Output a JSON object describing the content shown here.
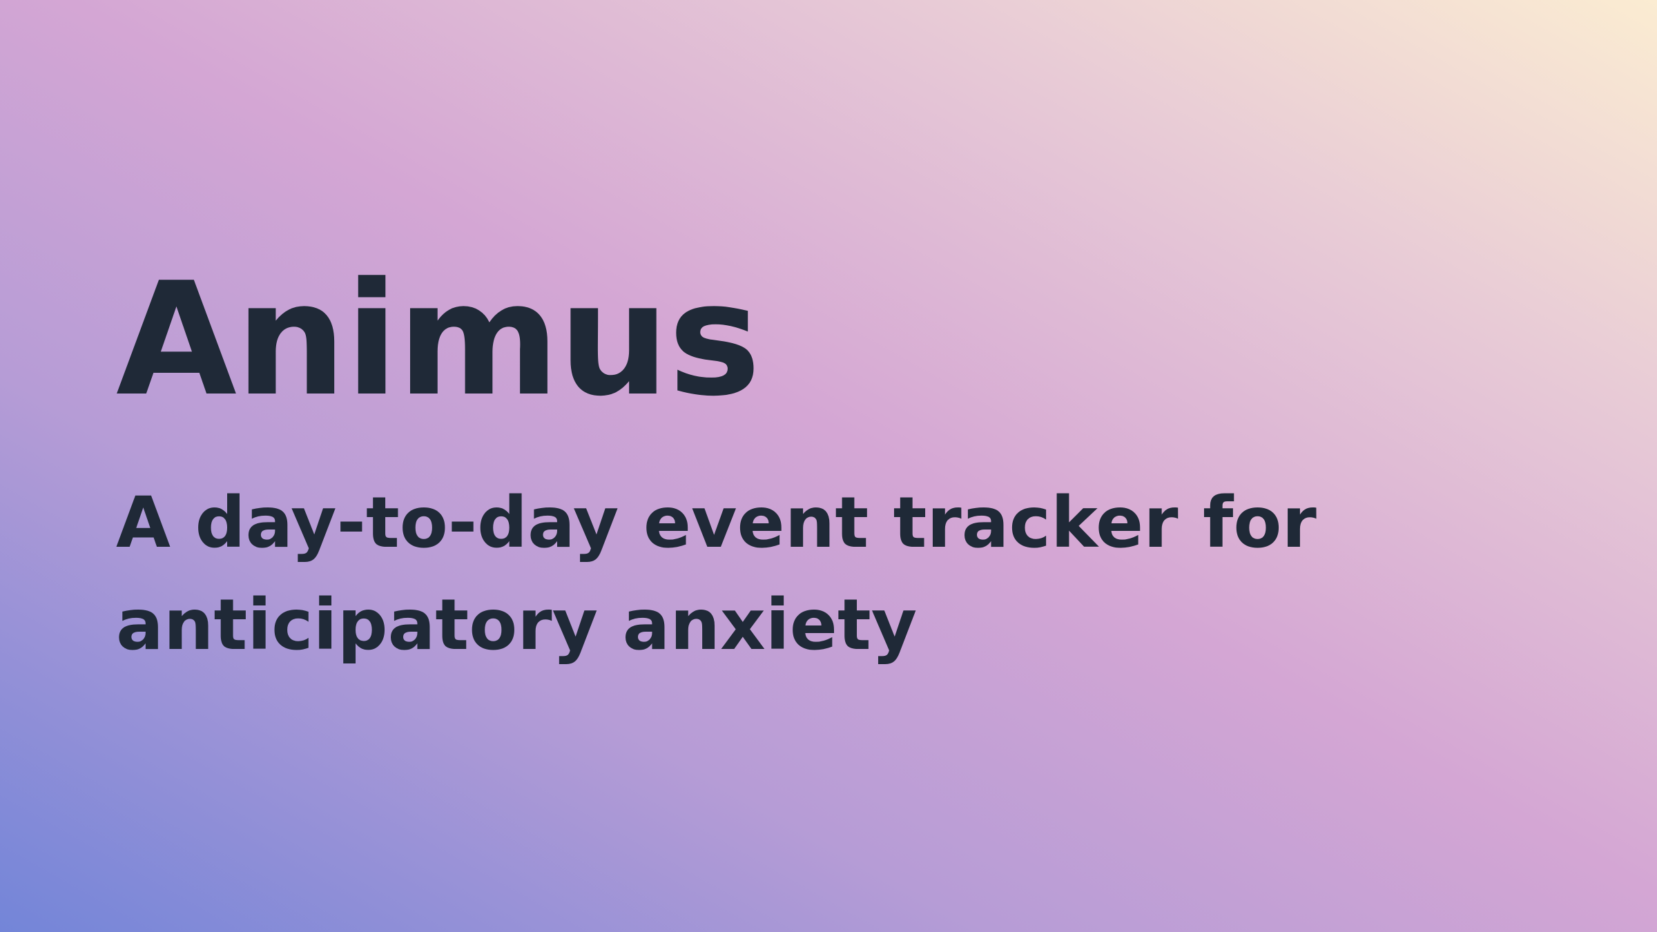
{
  "slide": {
    "title": "Animus",
    "subtitle_line1": "A day-to-day event tracker for",
    "subtitle_line2": "anticipatory anxiety"
  },
  "colors": {
    "text": "#1f2937",
    "gradient_bottom_left": "#7385d8",
    "gradient_middle": "#d4a6d4",
    "gradient_top_right": "#fbecd2"
  }
}
